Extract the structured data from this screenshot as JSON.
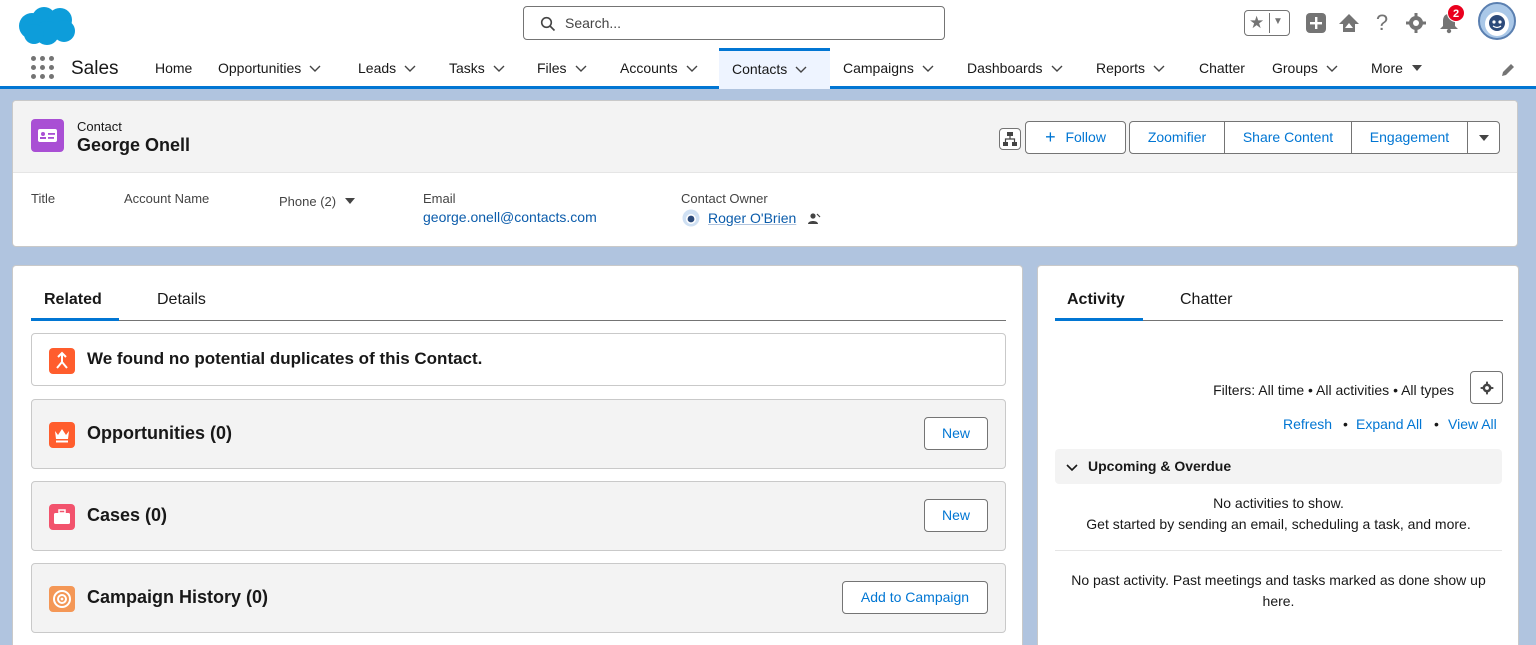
{
  "search": {
    "placeholder": "Search..."
  },
  "header": {
    "notification_count": "2"
  },
  "nav": {
    "app_name": "Sales",
    "items": [
      "Home",
      "Opportunities",
      "Leads",
      "Tasks",
      "Files",
      "Accounts",
      "Contacts",
      "Campaigns",
      "Dashboards",
      "Reports",
      "Chatter",
      "Groups",
      "More"
    ],
    "active": "Contacts"
  },
  "record": {
    "type": "Contact",
    "name": "George Onell",
    "actions": {
      "follow": "Follow",
      "zoomifier": "Zoomifier",
      "share": "Share Content",
      "engagement": "Engagement"
    },
    "fields": {
      "title_label": "Title",
      "account_label": "Account Name",
      "phone_label": "Phone (2)",
      "email_label": "Email",
      "email_value": "george.onell@contacts.com",
      "owner_label": "Contact Owner",
      "owner_value": "Roger O'Brien"
    }
  },
  "related": {
    "tabs": [
      "Related",
      "Details"
    ],
    "duplicates_msg": "We found no potential duplicates of this Contact.",
    "lists": [
      {
        "title": "Opportunities (0)",
        "button": "New"
      },
      {
        "title": "Cases (0)",
        "button": "New"
      },
      {
        "title": "Campaign History (0)",
        "button": "Add to Campaign"
      }
    ]
  },
  "activity": {
    "tabs": [
      "Activity",
      "Chatter"
    ],
    "filters": "Filters: All time • All activities • All types",
    "links": {
      "refresh": "Refresh",
      "expand": "Expand All",
      "view_all": "View All"
    },
    "upcoming": "Upcoming & Overdue",
    "no_activities": "No activities to show.",
    "get_started": "Get started by sending an email, scheduling a task, and more.",
    "no_past_1": "No past activity. Past meetings and tasks marked as done show up",
    "no_past_2": "here."
  },
  "colors": {
    "brand": "#0176d3",
    "contact_icon": "#a94fd4",
    "opportunity_icon": "#ff5d2d",
    "case_icon": "#f2536d",
    "campaign_icon": "#f49756"
  }
}
